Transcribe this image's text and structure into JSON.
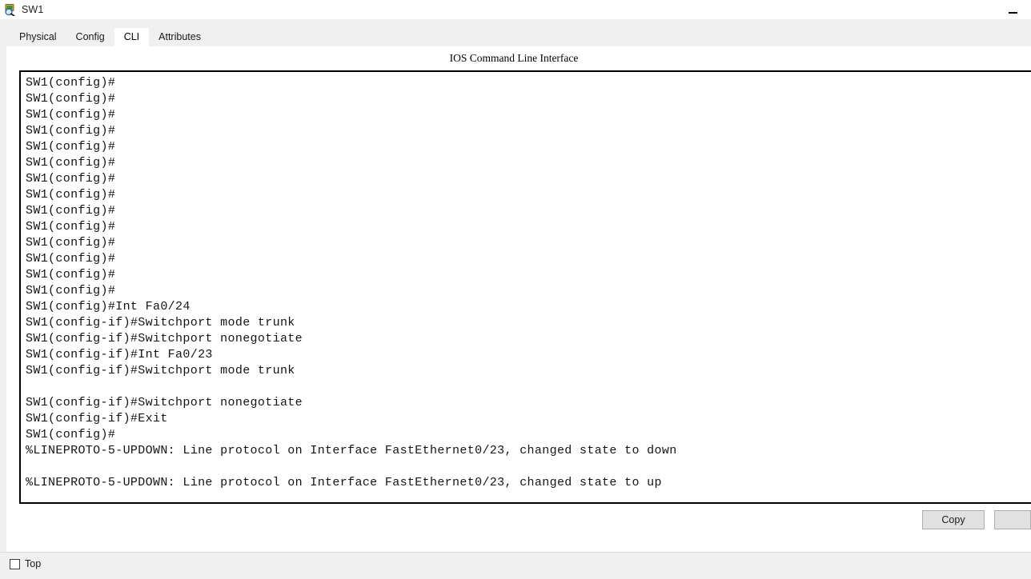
{
  "window": {
    "title": "SW1",
    "icon": "switch-device-icon",
    "controls": [
      {
        "name": "minimize",
        "glyph": "minimize-icon"
      }
    ]
  },
  "tabs": [
    {
      "label": "Physical",
      "active": false
    },
    {
      "label": "Config",
      "active": false
    },
    {
      "label": "CLI",
      "active": true
    },
    {
      "label": "Attributes",
      "active": false
    }
  ],
  "panel": {
    "caption": "IOS Command Line Interface"
  },
  "terminal": {
    "lines": [
      "SW1(config)#",
      "SW1(config)#",
      "SW1(config)#",
      "SW1(config)#",
      "SW1(config)#",
      "SW1(config)#",
      "SW1(config)#",
      "SW1(config)#",
      "SW1(config)#",
      "SW1(config)#",
      "SW1(config)#",
      "SW1(config)#",
      "SW1(config)#",
      "SW1(config)#",
      "SW1(config)#Int Fa0/24",
      "SW1(config-if)#Switchport mode trunk",
      "SW1(config-if)#Switchport nonegotiate",
      "SW1(config-if)#Int Fa0/23",
      "SW1(config-if)#Switchport mode trunk",
      "",
      "SW1(config-if)#Switchport nonegotiate",
      "SW1(config-if)#Exit",
      "SW1(config)#",
      "%LINEPROTO-5-UPDOWN: Line protocol on Interface FastEthernet0/23, changed state to down",
      "",
      "%LINEPROTO-5-UPDOWN: Line protocol on Interface FastEthernet0/23, changed state to up",
      ""
    ]
  },
  "buttons": {
    "copy_label": "Copy",
    "secondary_label": ""
  },
  "bottom": {
    "top_checkbox_label": "Top",
    "top_checkbox_checked": false
  },
  "colors": {
    "chrome": "#f0f0f0",
    "panel": "#ffffff",
    "terminal_border": "#000000",
    "terminal_text": "#141414",
    "button_face": "#e1e1e1",
    "button_border": "#adadad"
  }
}
